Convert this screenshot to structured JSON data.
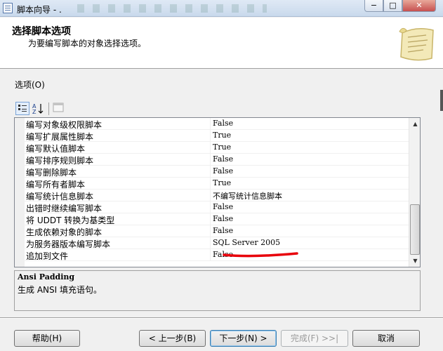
{
  "window": {
    "title": "脚本向导 - .",
    "min_icon": "−",
    "max_icon": "□",
    "close_icon": "✕"
  },
  "header": {
    "title": "选择脚本选项",
    "subtitle": "为要编写脚本的对象选择选项。"
  },
  "options_label": "选项(O)",
  "grid_rows": [
    {
      "name": "编写对象级权限脚本",
      "value": "False"
    },
    {
      "name": "编写扩展属性脚本",
      "value": "True"
    },
    {
      "name": "编写默认值脚本",
      "value": "True"
    },
    {
      "name": "编写排序规则脚本",
      "value": "False"
    },
    {
      "name": "编写删除脚本",
      "value": "False"
    },
    {
      "name": "编写所有者脚本",
      "value": "True"
    },
    {
      "name": "编写统计信息脚本",
      "value": "不编写统计信息脚本"
    },
    {
      "name": "出错时继续编写脚本",
      "value": "False"
    },
    {
      "name": "将 UDDT 转换为基类型",
      "value": "False"
    },
    {
      "name": "生成依赖对象的脚本",
      "value": "False"
    },
    {
      "name": "为服务器版本编写脚本",
      "value": "SQL Server 2005"
    },
    {
      "name": "追加到文件",
      "value": "False"
    }
  ],
  "description": {
    "title": "Ansi Padding",
    "text": "生成 ANSI 填充语句。"
  },
  "buttons": {
    "help": "帮助(H)",
    "prev": "< 上一步(B)",
    "next": "下一步(N) >",
    "finish": "完成(F) >>|",
    "cancel": "取消"
  },
  "colors": {
    "annotation": "#e8000b",
    "header_bg": "#ffffff",
    "dialog_bg": "#f0f0f0"
  }
}
